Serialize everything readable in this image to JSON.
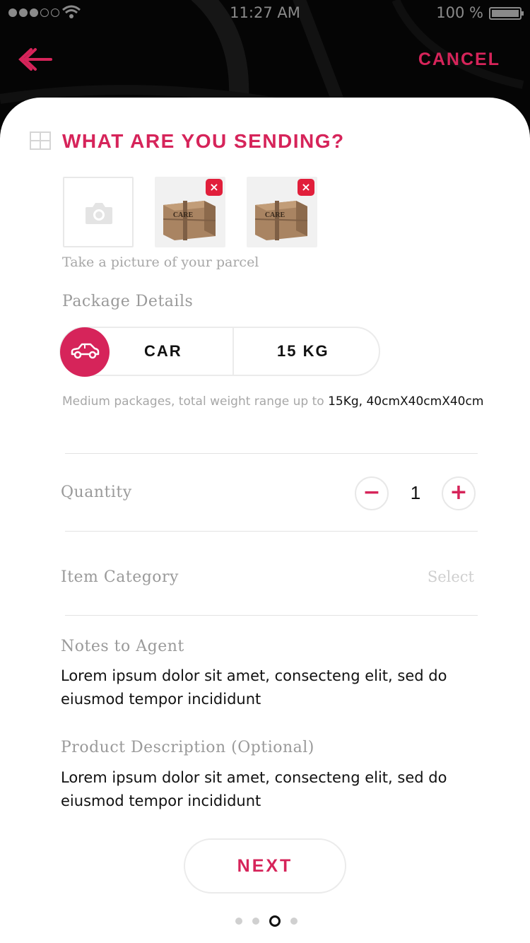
{
  "status_bar": {
    "time": "11:27 AM",
    "battery": "100 %"
  },
  "header": {
    "cancel_label": "CANCEL"
  },
  "section": {
    "title": "WHAT ARE YOU SENDING?"
  },
  "photos": {
    "hint": "Take a picture of your parcel",
    "remove_glyph": "×",
    "box_label": "CARE"
  },
  "package": {
    "label": "Package Details",
    "vehicle": "CAR",
    "weight": "15 KG",
    "description_prefix": "Medium packages, total weight range up to ",
    "description_highlight": "15Kg, 40cmX40cmX40cm"
  },
  "quantity": {
    "label": "Quantity",
    "value": "1",
    "minus": "−",
    "plus": "+"
  },
  "item_category": {
    "label": "Item Category",
    "placeholder": "Select"
  },
  "notes": {
    "label": "Notes to Agent",
    "value": "Lorem ipsum dolor sit amet, consecteng elit, sed do eiusmod tempor incididunt"
  },
  "product_description": {
    "label": "Product Description (Optional)",
    "value": "Lorem ipsum dolor sit amet, consecteng elit, sed do eiusmod tempor incididunt"
  },
  "footer": {
    "next_label": "NEXT",
    "pager": {
      "total": 4,
      "active": 3
    }
  },
  "colors": {
    "accent": "#d6245a",
    "remove": "#e11f3b",
    "muted": "#9a9a9a"
  }
}
